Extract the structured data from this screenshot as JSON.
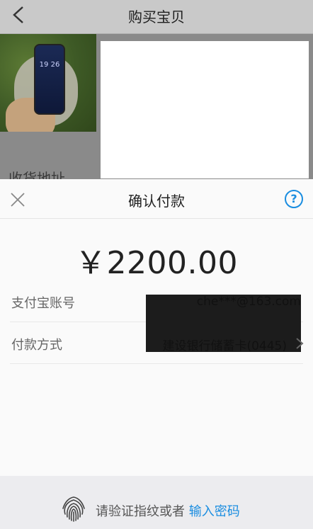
{
  "page": {
    "title": "购买宝贝",
    "address_label": "收货地址",
    "phone_time": "19 26"
  },
  "sheet": {
    "title": "确认付款",
    "amount": "￥2200.00",
    "rows": [
      {
        "label": "支付宝账号",
        "value": "che***@163.com"
      },
      {
        "label": "付款方式",
        "value": "建设银行储蓄卡(0445)"
      }
    ]
  },
  "footer": {
    "prompt": "请验证指纹或者",
    "link": "输入密码"
  },
  "colors": {
    "accent": "#1a8de0"
  }
}
